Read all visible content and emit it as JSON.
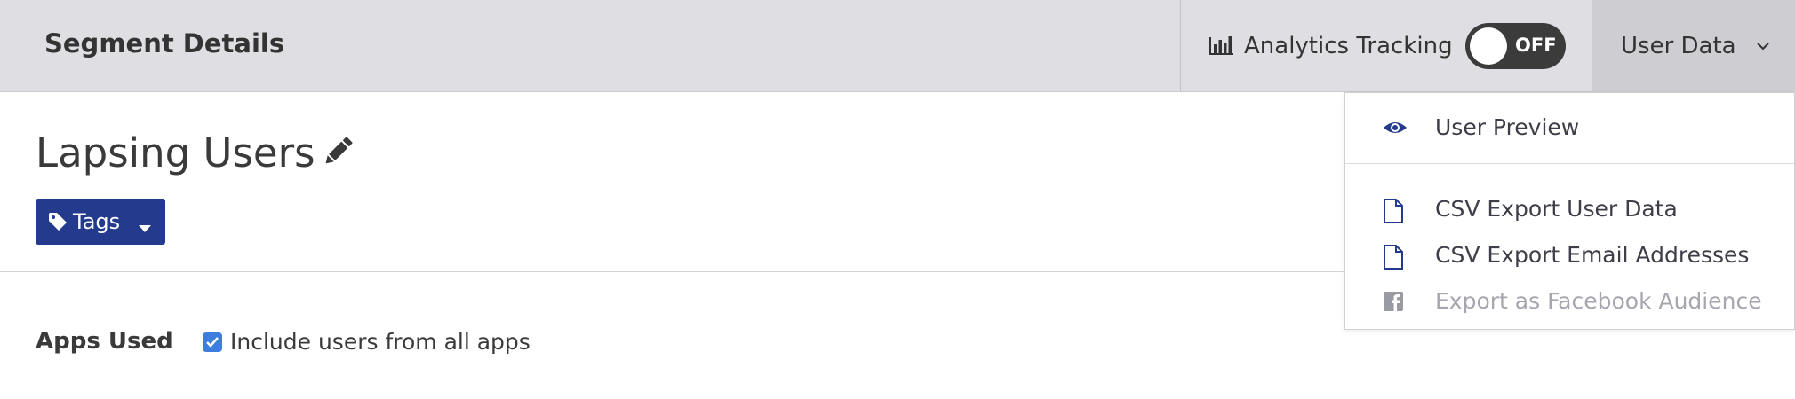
{
  "header": {
    "title": "Segment Details",
    "analytics_label": "Analytics Tracking",
    "toggle": {
      "state_label": "OFF",
      "on": false
    },
    "user_data_label": "User Data"
  },
  "segment": {
    "name": "Lapsing Users",
    "tags_label": "Tags"
  },
  "apps_used": {
    "label": "Apps Used",
    "include_all_label": "Include users from all apps",
    "include_all_checked": true
  },
  "user_data_menu": {
    "items": [
      {
        "label": "User Preview",
        "icon": "eye-icon",
        "enabled": true
      },
      {
        "label": "CSV Export User Data",
        "icon": "file-icon",
        "enabled": true
      },
      {
        "label": "CSV Export Email Addresses",
        "icon": "file-icon",
        "enabled": true
      },
      {
        "label": "Export as Facebook Audience",
        "icon": "facebook-icon",
        "enabled": false
      }
    ]
  },
  "colors": {
    "topbar_bg": "#dfdfe3",
    "accent_blue": "#233a8d",
    "checkbox_blue": "#3d7dde",
    "toggle_bg": "#3b3b3b",
    "disabled_text": "#a6a6ae"
  }
}
